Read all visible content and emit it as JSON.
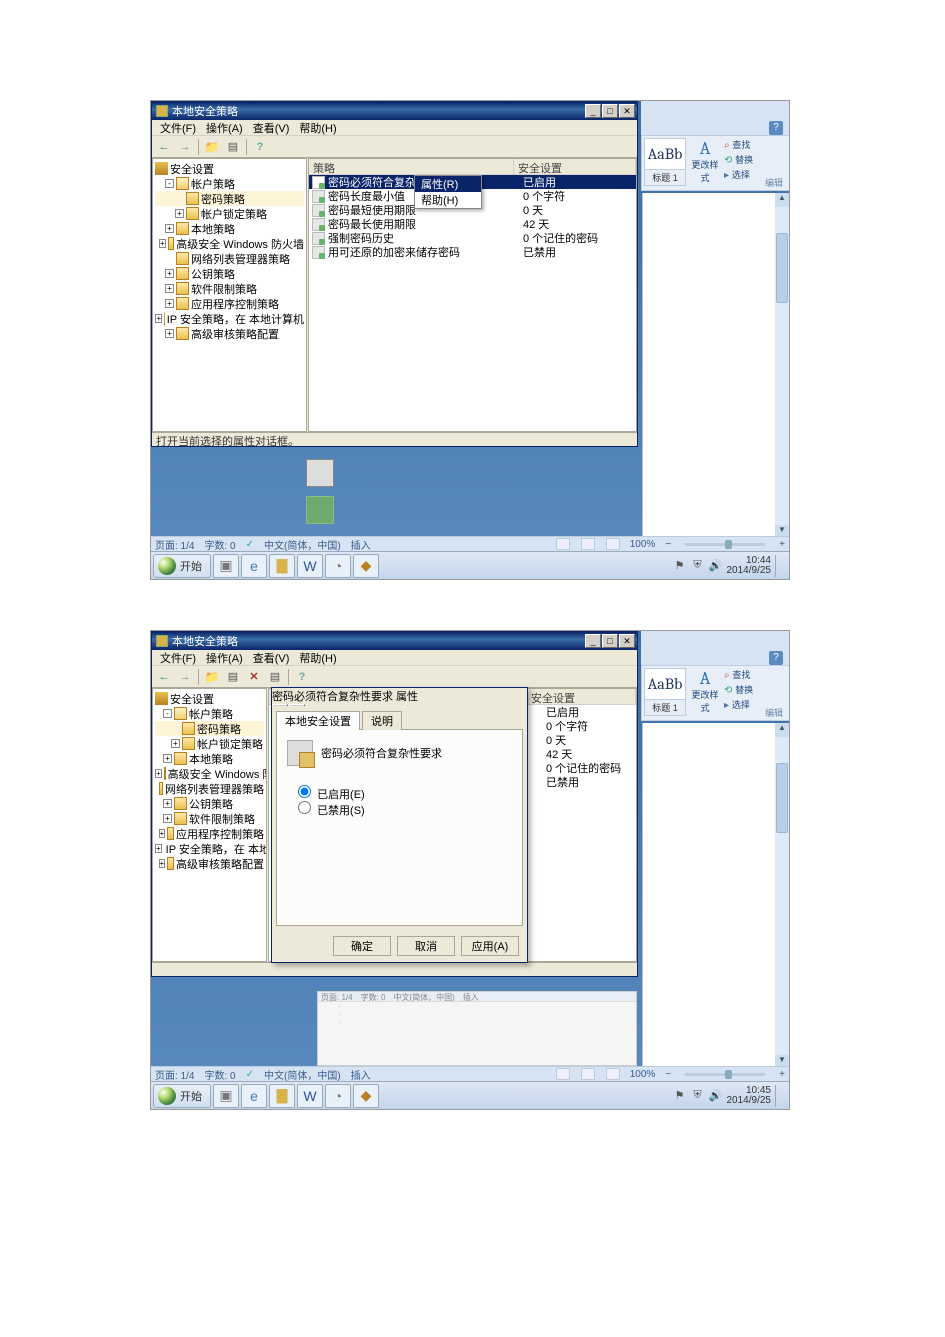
{
  "shot1": {
    "mmc": {
      "title": "本地安全策略",
      "menus": [
        "文件(F)",
        "操作(A)",
        "查看(V)",
        "帮助(H)"
      ],
      "tree": {
        "root": "安全设置",
        "items": [
          {
            "label": "帐户策略",
            "level": 1,
            "exp": "-",
            "icon": "folderopen"
          },
          {
            "label": "密码策略",
            "level": 2,
            "exp": "",
            "icon": "folder",
            "selected": true
          },
          {
            "label": "帐户锁定策略",
            "level": 2,
            "exp": "+",
            "icon": "folder"
          },
          {
            "label": "本地策略",
            "level": 1,
            "exp": "+",
            "icon": "folder"
          },
          {
            "label": "高级安全 Windows 防火墙",
            "level": 1,
            "exp": "+",
            "icon": "folder"
          },
          {
            "label": "网络列表管理器策略",
            "level": 1,
            "exp": "",
            "icon": "folder"
          },
          {
            "label": "公钥策略",
            "level": 1,
            "exp": "+",
            "icon": "folder"
          },
          {
            "label": "软件限制策略",
            "level": 1,
            "exp": "+",
            "icon": "folder"
          },
          {
            "label": "应用程序控制策略",
            "level": 1,
            "exp": "+",
            "icon": "folder"
          },
          {
            "label": "IP 安全策略，在 本地计算机",
            "level": 1,
            "exp": "+",
            "icon": "shield"
          },
          {
            "label": "高级审核策略配置",
            "level": 1,
            "exp": "+",
            "icon": "folder"
          }
        ]
      },
      "list": {
        "headers": [
          "策略",
          "安全设置"
        ],
        "rows": [
          {
            "name": "密码必须符合复杂性要求",
            "value": "已启用",
            "selected": true
          },
          {
            "name": "密码长度最小值",
            "value": "0 个字符"
          },
          {
            "name": "密码最短使用期限",
            "value": "0 天"
          },
          {
            "name": "密码最长使用期限",
            "value": "42 天"
          },
          {
            "name": "强制密码历史",
            "value": "0 个记住的密码"
          },
          {
            "name": "用可还原的加密来储存密码",
            "value": "已禁用"
          }
        ]
      },
      "context_menu": [
        "属性(R)",
        "帮助(H)"
      ],
      "status": "打开当前选择的属性对话框。"
    },
    "word_status": {
      "page": "页面: 1/4",
      "words": "字数: 0",
      "lang": "中文(简体，中国)",
      "mode": "插入",
      "zoom": "100%"
    },
    "ribbon": {
      "style_preview": "AaBb",
      "style_name": "标题 1",
      "change_styles": "更改样式",
      "find": "查找",
      "replace": "替换",
      "select": "选择",
      "group": "编辑"
    },
    "taskbar": {
      "start": "开始",
      "time": "10:44",
      "date": "2014/9/25"
    }
  },
  "shot2": {
    "mmc": {
      "title": "本地安全策略",
      "menus": [
        "文件(F)",
        "操作(A)",
        "查看(V)",
        "帮助(H)"
      ],
      "tree": {
        "root": "安全设置",
        "items": [
          {
            "label": "帐户策略",
            "level": 1,
            "exp": "-",
            "icon": "folderopen"
          },
          {
            "label": "密码策略",
            "level": 2,
            "exp": "",
            "icon": "folder",
            "selected": true
          },
          {
            "label": "帐户锁定策略",
            "level": 2,
            "exp": "+",
            "icon": "folder"
          },
          {
            "label": "本地策略",
            "level": 1,
            "exp": "+",
            "icon": "folder"
          },
          {
            "label": "高级安全 Windows 防火墙",
            "level": 1,
            "exp": "+",
            "icon": "folder"
          },
          {
            "label": "网络列表管理器策略",
            "level": 1,
            "exp": "",
            "icon": "folder"
          },
          {
            "label": "公钥策略",
            "level": 1,
            "exp": "+",
            "icon": "folder"
          },
          {
            "label": "软件限制策略",
            "level": 1,
            "exp": "+",
            "icon": "folder"
          },
          {
            "label": "应用程序控制策略",
            "level": 1,
            "exp": "+",
            "icon": "folder"
          },
          {
            "label": "IP 安全策略，在 本地计算",
            "level": 1,
            "exp": "+",
            "icon": "shield"
          },
          {
            "label": "高级审核策略配置",
            "level": 1,
            "exp": "+",
            "icon": "folder"
          }
        ]
      },
      "list": {
        "headers": [
          "",
          "安全设置"
        ],
        "rows": [
          {
            "value": "已启用"
          },
          {
            "value": "0 个字符"
          },
          {
            "value": "0 天"
          },
          {
            "value": "42 天"
          },
          {
            "value": "0 个记住的密码"
          },
          {
            "value": "已禁用"
          }
        ]
      },
      "status": ""
    },
    "dialog": {
      "title": "密码必须符合复杂性要求 属性",
      "tabs": [
        "本地安全设置",
        "说明"
      ],
      "label": "密码必须符合复杂性要求",
      "opt_enabled": "已启用(E)",
      "opt_disabled": "已禁用(S)",
      "ok": "确定",
      "cancel": "取消",
      "apply": "应用(A)"
    },
    "word_status": {
      "page": "页面: 1/4",
      "words": "字数: 0",
      "lang": "中文(简体，中国)",
      "mode": "插入",
      "zoom": "100%"
    },
    "ribbon": {
      "style_preview": "AaBb",
      "style_name": "标题 1",
      "change_styles": "更改样式",
      "find": "查找",
      "replace": "替换",
      "select": "选择",
      "group": "编辑"
    },
    "taskbar": {
      "start": "开始",
      "time": "10:45",
      "date": "2014/9/25"
    },
    "mini_preview": {
      "bar": "页面: 1/4　字数: 0　中文(简体，中国)　插入"
    }
  }
}
